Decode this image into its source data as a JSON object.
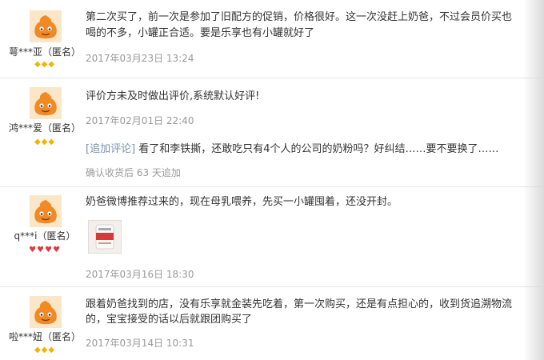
{
  "reviews": [
    {
      "user": "萼***亚（匿名）",
      "rank": "◆◆◆",
      "line1": "第二次买了，前一次是参加了旧配方的促销，价格很好。这一次没赶上奶爸，不过会员价买也",
      "line2": "喝的不多，小罐正合适。要是乐享也有小罐就好了",
      "date": "2017年03月23日 13:24"
    },
    {
      "user": "鸿***爱（匿名）",
      "rank": "◆◆◆",
      "line1": "评价方未及时做出评价,系统默认好评!",
      "date": "2017年02月01日 22:40",
      "append_tag": "[追加评论]",
      "append_text": " 看了和李铁撕，还敢吃只有4个人的公司的奶粉吗？好纠结……要不要换了……",
      "append_note": "确认收货后 63 天追加"
    },
    {
      "user": "q***i（匿名）",
      "rank": "♥♥♥♥",
      "line1": "奶爸微博推荐过来的，现在母乳喂养，先买一小罐囤着，还没开封。",
      "date": "2017年03月16日 18:30"
    },
    {
      "user": "啦***妞（匿名）",
      "rank": "◆◆◆",
      "line1": "跟着奶爸找到的店，没有乐享就金装先吃着，第一次购买，还是有点担心的，收到货追溯物流",
      "line2": "的，宝宝接受的话以后就跟团购买了",
      "date": "2017年03月14日 10:31"
    }
  ],
  "colors": {
    "rank_gold": "#f2b400",
    "rank_red": "#e0393e",
    "avatar": "#f08a24",
    "date_text": "#999999",
    "append_tag": "#7a91b0"
  }
}
